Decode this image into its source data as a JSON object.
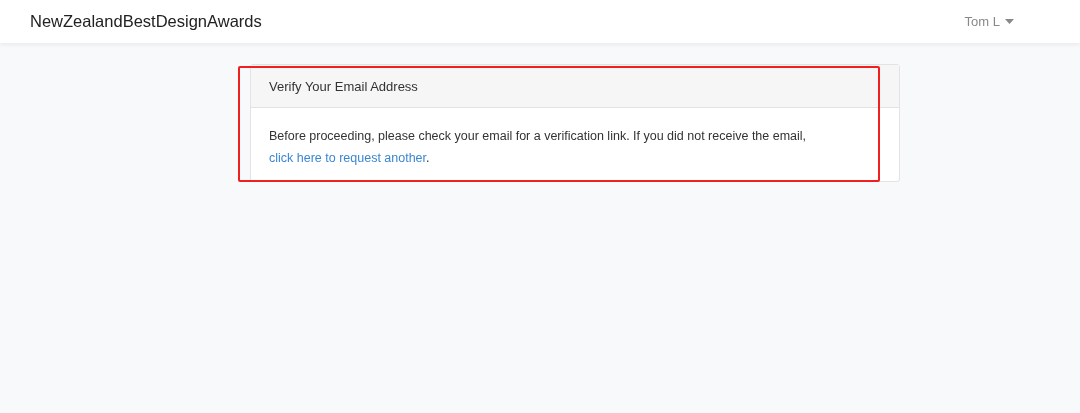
{
  "navbar": {
    "brand": "NewZealandBestDesignAwards",
    "user_menu": {
      "label": "Tom L",
      "expanded": false
    }
  },
  "card": {
    "header": "Verify Your Email Address",
    "body": {
      "text": "Before proceeding, please check your email for a verification link. If you did not receive the email,",
      "link": "click here to request another",
      "after_link": "."
    },
    "highlighted": true
  }
}
